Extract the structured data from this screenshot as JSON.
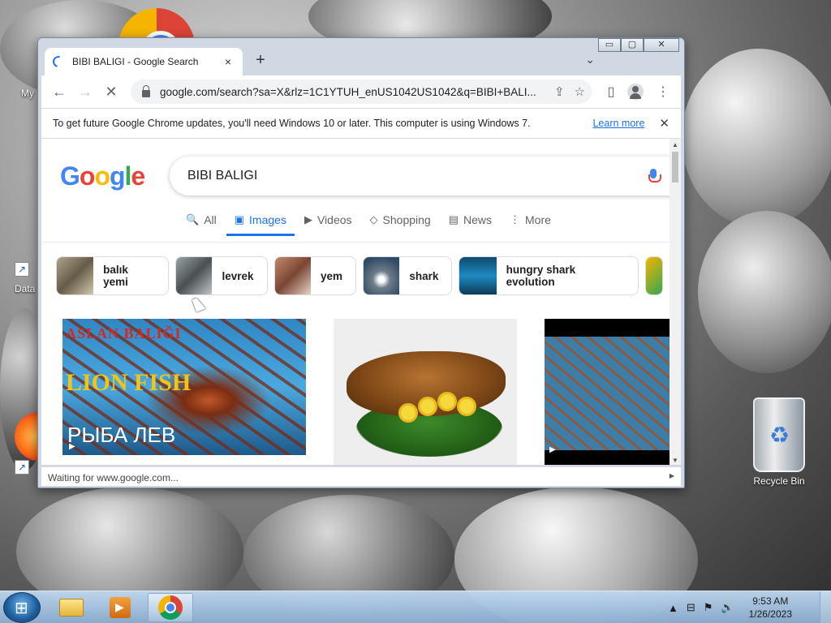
{
  "desktop": {
    "icons": [
      {
        "label": "My",
        "kind": "computer"
      },
      {
        "label": "Data",
        "kind": "shortcut"
      },
      {
        "label": "Recycle Bin",
        "kind": "recycle-bin"
      }
    ]
  },
  "browser": {
    "tab": {
      "title": "BIBI BALIGI - Google Search",
      "close_icon": "×",
      "new_tab_icon": "+"
    },
    "window_controls": {
      "minimize": "▭",
      "maximize": "▢",
      "close": "✕"
    },
    "tab_search_icon": "⌄",
    "toolbar": {
      "back_icon": "←",
      "forward_icon": "→",
      "reload_icon": "✕",
      "url": "google.com/search?sa=X&rlz=1C1YTUH_enUS1042US1042&q=BIBI+BALI...",
      "share_icon": "⇪",
      "bookmark_icon": "☆",
      "sidepanel_icon": "▯",
      "menu_icon": "⋮"
    },
    "infobar": {
      "message": "To get future Google Chrome updates, you'll need Windows 10 or later. This computer is using Windows 7.",
      "link": "Learn more",
      "close_icon": "✕"
    },
    "status": "Waiting for www.google.com..."
  },
  "google": {
    "logo_letters": [
      "G",
      "o",
      "o",
      "g",
      "l",
      "e"
    ],
    "query": "BIBI BALIGI",
    "tabs": [
      {
        "label": "All",
        "icon": "search-icon",
        "glyph": "🔍"
      },
      {
        "label": "Images",
        "icon": "image-icon",
        "glyph": "▣",
        "active": true
      },
      {
        "label": "Videos",
        "icon": "video-icon",
        "glyph": "▶"
      },
      {
        "label": "Shopping",
        "icon": "tag-icon",
        "glyph": "◇"
      },
      {
        "label": "News",
        "icon": "news-icon",
        "glyph": "▤"
      },
      {
        "label": "More",
        "icon": "more-icon",
        "glyph": "⋮"
      }
    ],
    "chips": [
      {
        "label": "balık yemi"
      },
      {
        "label": "levrek"
      },
      {
        "label": "yem"
      },
      {
        "label": "shark"
      },
      {
        "label": "hungry shark evolution"
      }
    ],
    "results": [
      {
        "overlay_top": "ASLAN BALIĞI",
        "overlay_mid": "LION FISH",
        "overlay_bottom": "РЫБА ЛЕВ",
        "has_video": true
      },
      {
        "has_video": false
      },
      {
        "has_video": true
      }
    ]
  },
  "taskbar": {
    "apps": [
      "file-explorer",
      "media-player",
      "chrome"
    ],
    "active_app": "chrome",
    "time": "9:53 AM",
    "date": "1/26/2023",
    "tray_icons": [
      "▲",
      "⊟",
      "⚑",
      "🔊"
    ]
  }
}
